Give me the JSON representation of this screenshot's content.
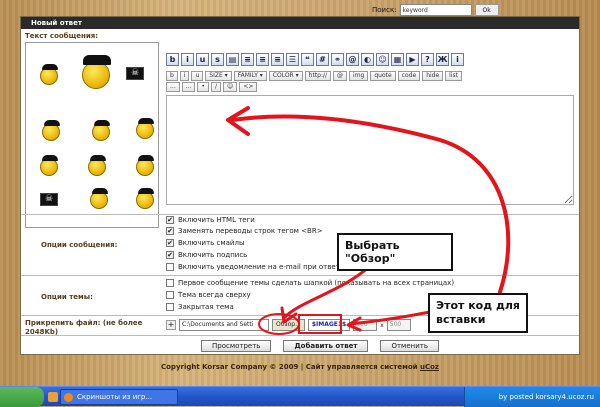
{
  "search": {
    "label": "Поиск:",
    "value": "keyword",
    "button": "Ok"
  },
  "panel": {
    "title": "Новый ответ"
  },
  "message": {
    "label": "Текст сообщения:"
  },
  "toolbar": {
    "icons": [
      "b",
      "i",
      "u",
      "s"
    ],
    "row2": [
      "b",
      "i",
      "u",
      "SIZE ▾",
      "FAMILY ▾",
      "COLOR ▾",
      "http://",
      "@",
      "img",
      "quote",
      "code",
      "hide",
      "list"
    ],
    "row3": [
      "...",
      "...",
      "•",
      "/",
      "☺",
      "<>"
    ]
  },
  "message_options": {
    "label": "Опции сообщения:",
    "items": [
      {
        "text": "Включить HTML теги",
        "checked": true
      },
      {
        "text": "Заменять переводы строк тегом <BR>",
        "checked": true
      },
      {
        "text": "Включить смайлы",
        "checked": true
      },
      {
        "text": "Включить подпись",
        "checked": true
      },
      {
        "text": "Включить уведомление на e-mail при ответах",
        "checked": false
      }
    ]
  },
  "topic_options": {
    "label": "Опции темы:",
    "items": [
      {
        "text": "Первое сообщение темы сделать шапкой (показывать на всех страницах)",
        "checked": false
      },
      {
        "text": "Тема всегда сверху",
        "checked": false
      },
      {
        "text": "Закрытая тема",
        "checked": false
      }
    ]
  },
  "attach": {
    "label": "Прикрепить файл: (не более 2048Kb)",
    "plus": "+",
    "path": "C:\\Documents and Setti",
    "browse": "Обзор...",
    "code": "$IMAGE1$",
    "width": "500",
    "x": "x",
    "height": "500"
  },
  "actions": {
    "preview": "Просмотреть",
    "submit": "Добавить ответ",
    "cancel": "Отменить"
  },
  "footer": {
    "text": "Copyright Korsar Company © 2009 | Сайт управляется системой",
    "link": "uCoz"
  },
  "annotations": {
    "browse_hint": "Выбрать \"Обзор\"",
    "code_hint": "Этот код для вставки",
    "arrow_color": "#e4141c"
  },
  "taskbar": {
    "task_label": "Скриншоты из игр...",
    "tray_text": "by posted korsary4.ucoz.ru"
  }
}
